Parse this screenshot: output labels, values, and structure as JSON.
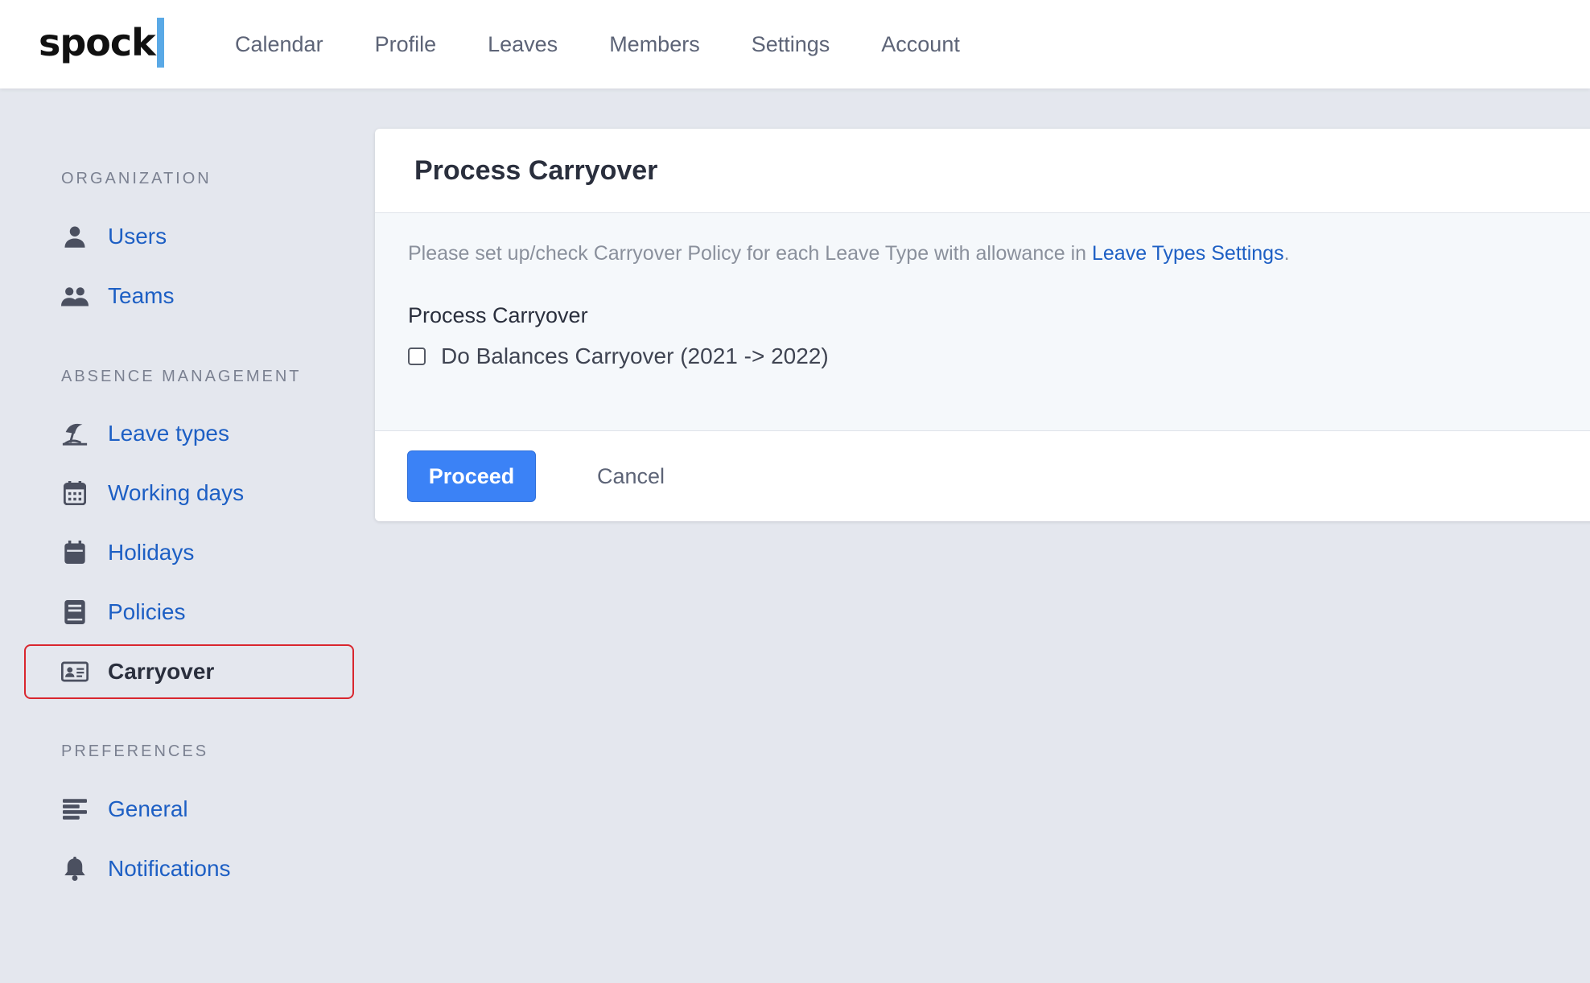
{
  "header": {
    "logo": "spock",
    "nav": [
      "Calendar",
      "Profile",
      "Leaves",
      "Members",
      "Settings",
      "Account"
    ]
  },
  "sidebar": {
    "sections": {
      "organization": "ORGANIZATION",
      "absence": "ABSENCE MANAGEMENT",
      "preferences": "PREFERENCES"
    },
    "items": {
      "users": {
        "label": "Users",
        "icon": "user-icon"
      },
      "teams": {
        "label": "Teams",
        "icon": "users-icon"
      },
      "leave_types": {
        "label": "Leave types",
        "icon": "umbrella-beach-icon"
      },
      "working_days": {
        "label": "Working days",
        "icon": "calendar-grid-icon"
      },
      "holidays": {
        "label": "Holidays",
        "icon": "calendar-icon"
      },
      "policies": {
        "label": "Policies",
        "icon": "book-icon"
      },
      "carryover": {
        "label": "Carryover",
        "icon": "id-card-icon",
        "active": true
      },
      "general": {
        "label": "General",
        "icon": "align-left-icon"
      },
      "notifications": {
        "label": "Notifications",
        "icon": "bell-icon"
      }
    }
  },
  "card": {
    "title": "Process Carryover",
    "info_prefix": "Please set up/check Carryover Policy for each Leave Type with allowance in ",
    "info_link": "Leave Types Settings",
    "info_suffix": ".",
    "field_label": "Process Carryover",
    "checkbox_label": "Do Balances Carryover (2021 -> 2022)",
    "checkbox_checked": false,
    "proceed_label": "Proceed",
    "cancel_label": "Cancel"
  },
  "colors": {
    "link": "#1d5fc4",
    "primary": "#3b82f6",
    "highlight": "#d9262e",
    "icon": "#4b5060"
  }
}
